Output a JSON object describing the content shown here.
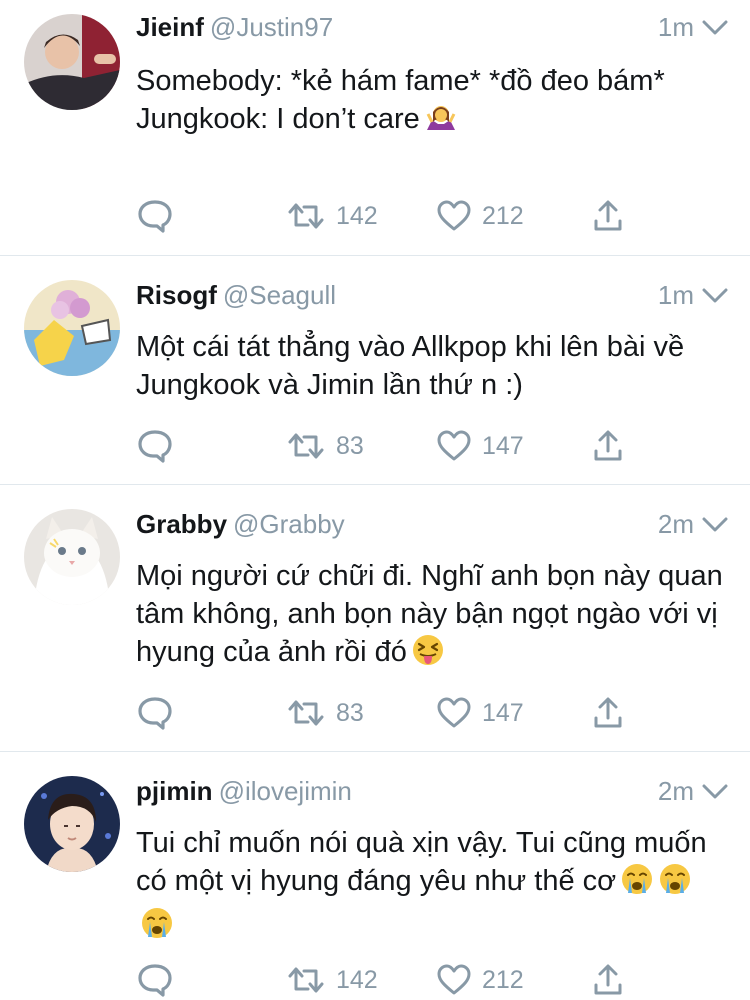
{
  "tweets": [
    {
      "name": "Jieinf",
      "handle": "@Justin97",
      "time": "1m",
      "text": "Somebody: *kẻ hám fame* *đồ đeo bám*\nJungkook: I don’t care",
      "emoji": [
        "woman-shrugging-emoji"
      ],
      "retweets": "142",
      "likes": "212"
    },
    {
      "name": "Risogf",
      "handle": "@Seagull",
      "time": "1m",
      "text": "Một cái tát thẳng vào Allkpop khi lên bài về Jungkook và Jimin lần thứ n :)",
      "emoji": [],
      "retweets": "83",
      "likes": "147"
    },
    {
      "name": "Grabby",
      "handle": "@Grabby",
      "time": "2m",
      "text": "Mọi người cứ chữi đi. Nghĩ anh bọn này quan tâm không, anh bọn này bận ngọt ngào với vị hyung của ảnh rồi đó",
      "emoji": [
        "squinting-tongue-emoji"
      ],
      "retweets": "83",
      "likes": "147"
    },
    {
      "name": "pjimin",
      "handle": "@ilovejimin",
      "time": "2m",
      "text": "Tui chỉ muốn nói quà xịn vậy. Tui cũng muốn có một vị hyung đáng yêu như thế cơ",
      "emoji": [
        "crying-face-emoji",
        "crying-face-emoji",
        "crying-face-emoji"
      ],
      "retweets": "142",
      "likes": "212"
    }
  ],
  "colors": {
    "text": "#14171a",
    "muted": "#8899a6",
    "divider": "#e1e8ed"
  },
  "icons": [
    "reply-icon",
    "retweet-icon",
    "like-icon",
    "share-icon",
    "chevron-down-icon"
  ]
}
